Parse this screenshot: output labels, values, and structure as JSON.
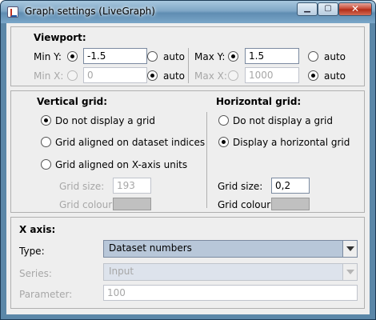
{
  "window": {
    "title": "Graph settings (LiveGraph)",
    "buttons": {
      "minimize": "▁",
      "maximize": "▢",
      "close": "✕"
    }
  },
  "viewport": {
    "heading": "Viewport:",
    "min_y": {
      "label": "Min Y:",
      "value": "-1.5",
      "auto_label": "auto",
      "selected": "value"
    },
    "min_x": {
      "label": "Min X:",
      "value": "0",
      "auto_label": "auto",
      "selected": "auto"
    },
    "max_y": {
      "label": "Max Y:",
      "value": "1.5",
      "auto_label": "auto",
      "selected": "value"
    },
    "max_x": {
      "label": "Max X:",
      "value": "1000",
      "auto_label": "auto",
      "selected": "auto"
    }
  },
  "vertical_grid": {
    "heading": "Vertical grid:",
    "options": [
      "Do not display a grid",
      "Grid aligned on dataset indices",
      "Grid aligned on X-axis units"
    ],
    "selected_index": 0,
    "grid_size_label": "Grid size:",
    "grid_size_value": "193",
    "grid_colour_label": "Grid colour:",
    "grid_colour": "#c0c0c0"
  },
  "horizontal_grid": {
    "heading": "Horizontal grid:",
    "options": [
      "Do not display a grid",
      "Display a horizontal grid"
    ],
    "selected_index": 1,
    "grid_size_label": "Grid size:",
    "grid_size_value": "0,2",
    "grid_colour_label": "Grid colour:",
    "grid_colour": "#c0c0c0"
  },
  "x_axis": {
    "heading": "X axis:",
    "type_label": "Type:",
    "type_value": "Dataset numbers",
    "series_label": "Series:",
    "series_value": "Input",
    "parameter_label": "Parameter:",
    "parameter_value": "100"
  },
  "colors": {
    "window_frame": "#5b87a8",
    "dialog_background": "#eeeeee",
    "selected_combo": "#b8c7d9"
  }
}
